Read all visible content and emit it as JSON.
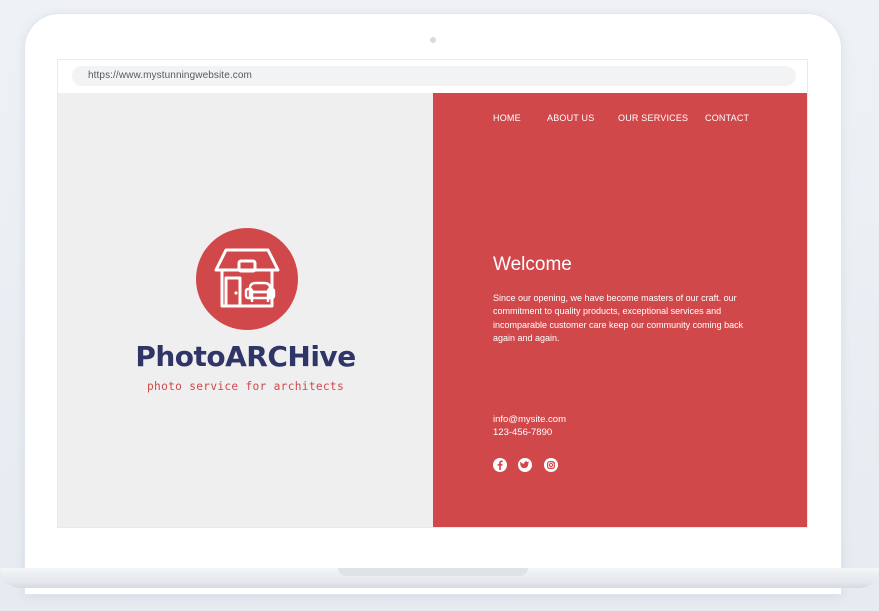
{
  "browser": {
    "url": "https://www.mystunningwebsite.com"
  },
  "brand": {
    "name": "PhotoARCHive",
    "tagline": "photo service for architects"
  },
  "nav": {
    "items": [
      {
        "label": "HOME"
      },
      {
        "label": "ABOUT US"
      },
      {
        "label": "OUR SERVICES"
      },
      {
        "label": "CONTACT"
      }
    ]
  },
  "hero": {
    "heading": "Welcome",
    "body": "Since our opening, we have become masters of our craft. our commitment to quality products, exceptional services and incomparable customer care keep our community coming back again and again."
  },
  "contact": {
    "email": "info@mysite.com",
    "phone": "123-456-7890"
  },
  "social": [
    {
      "icon": "facebook-icon"
    },
    {
      "icon": "twitter-icon"
    },
    {
      "icon": "instagram-icon"
    }
  ],
  "colors": {
    "accent_red": "#d1484b",
    "brand_navy": "#2f3566",
    "left_panel": "#f0efef"
  }
}
